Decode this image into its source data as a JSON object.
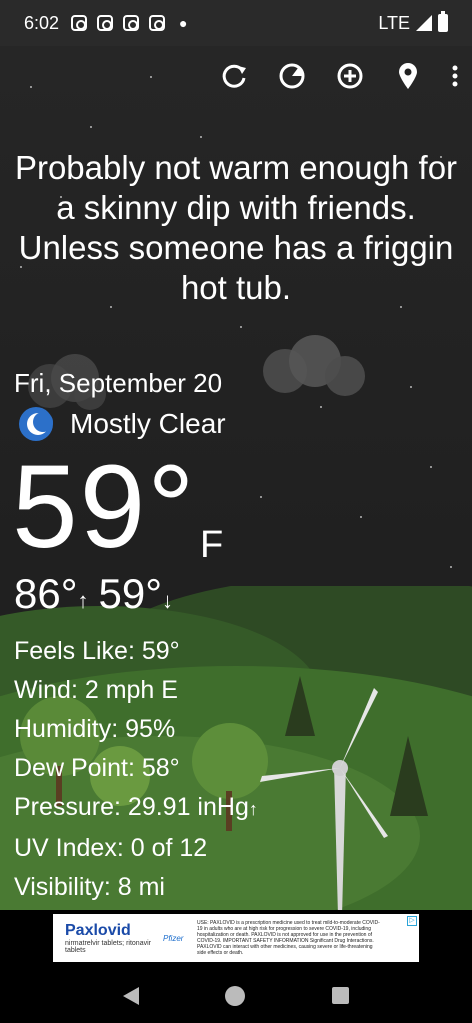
{
  "status_bar": {
    "time": "6:02",
    "network": "LTE",
    "notification_icons": [
      "instagram-icon",
      "instagram-icon",
      "instagram-icon",
      "instagram-icon"
    ]
  },
  "toolbar": {
    "icons": [
      "refresh-icon",
      "radar-icon",
      "add-location-icon",
      "location-pin-icon",
      "more-vert-icon"
    ]
  },
  "quote": "Probably not warm enough for a skinny dip with friends. Unless someone has a friggin hot tub.",
  "weather": {
    "date": "Fri, September 20",
    "condition": "Mostly Clear",
    "temperature": "59°",
    "unit": "F",
    "high": "86°",
    "low": "59°"
  },
  "details": {
    "feels_like": "Feels Like:  59°",
    "wind": "Wind:  2 mph E",
    "humidity": "Humidity:  95%",
    "dew_point": "Dew Point:  58°",
    "pressure": "Pressure:  29.91 inHg",
    "uv_index": "UV Index:  0 of 12",
    "visibility": "Visibility:  8 mi"
  },
  "ad": {
    "brand": "Paxlovid",
    "brand_sub": "nirmatrelvir tablets; ritonavir tablets",
    "sponsor": "Pfizer",
    "text": "USE: PAXLOVID is a prescription medicine used to treat mild-to-moderate COVID-19 in adults who are at high risk for progression to severe COVID-19, including hospitalization or death. PAXLOVID is not approved for use in the prevention of COVID-19. IMPORTANT SAFETY INFORMATION Significant Drug Interactions. PAXLOVID can interact with other medicines, causing severe or life-threatening side effects or death."
  },
  "colors": {
    "sky": "#222222",
    "hills": "#3f6e2c",
    "ad_brand": "#1a4aa8"
  }
}
